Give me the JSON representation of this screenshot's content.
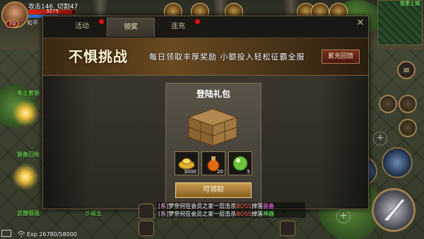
{
  "hud": {
    "attack_label": "攻击146",
    "cut_label": "切割47",
    "hp_text": "3275",
    "hp_fraction": 0.92,
    "mp_fraction": 0.8,
    "level": "70",
    "player_name": "和平"
  },
  "npcs": [
    "本土套装",
    "装备回收",
    "武器锻造",
    "沙城主"
  ],
  "minimap": {
    "name": "盟重土城"
  },
  "modal": {
    "tabs": [
      {
        "label": "活动",
        "active": false,
        "red_dot": true
      },
      {
        "label": "领奖",
        "active": true,
        "red_dot": false
      },
      {
        "label": "连充",
        "active": false,
        "red_dot": true
      }
    ],
    "banner_title": "不惧挑战",
    "banner_subtitle": "每日领取丰厚奖励 小额投入轻松征霸全服",
    "banner_button": "累充回馈",
    "card": {
      "title": "登陆礼包",
      "items": [
        {
          "icon": "gold-ingot-icon",
          "count": "3000"
        },
        {
          "icon": "potion-icon",
          "count": "20"
        },
        {
          "icon": "orb-icon",
          "count": "5"
        }
      ],
      "claim_label": "可领取"
    }
  },
  "chat": [
    {
      "prefix": "[系]",
      "text": "梦奈何在会员之家一层击杀",
      "tag": "BOSS",
      "suffix": "掉落",
      "item": "装备"
    },
    {
      "prefix": "[系]",
      "text": "梦奈何在会员之家一层击杀",
      "tag": "BOSS",
      "suffix": "掉落",
      "item": "神器"
    }
  ],
  "exp_text": "Exp 26780/58000",
  "colors": {
    "accent_gold": "#c89a50",
    "banner": "#6a4a20",
    "hp": "#e02010",
    "mp": "#2a70e0",
    "red_dot": "#e01010"
  }
}
